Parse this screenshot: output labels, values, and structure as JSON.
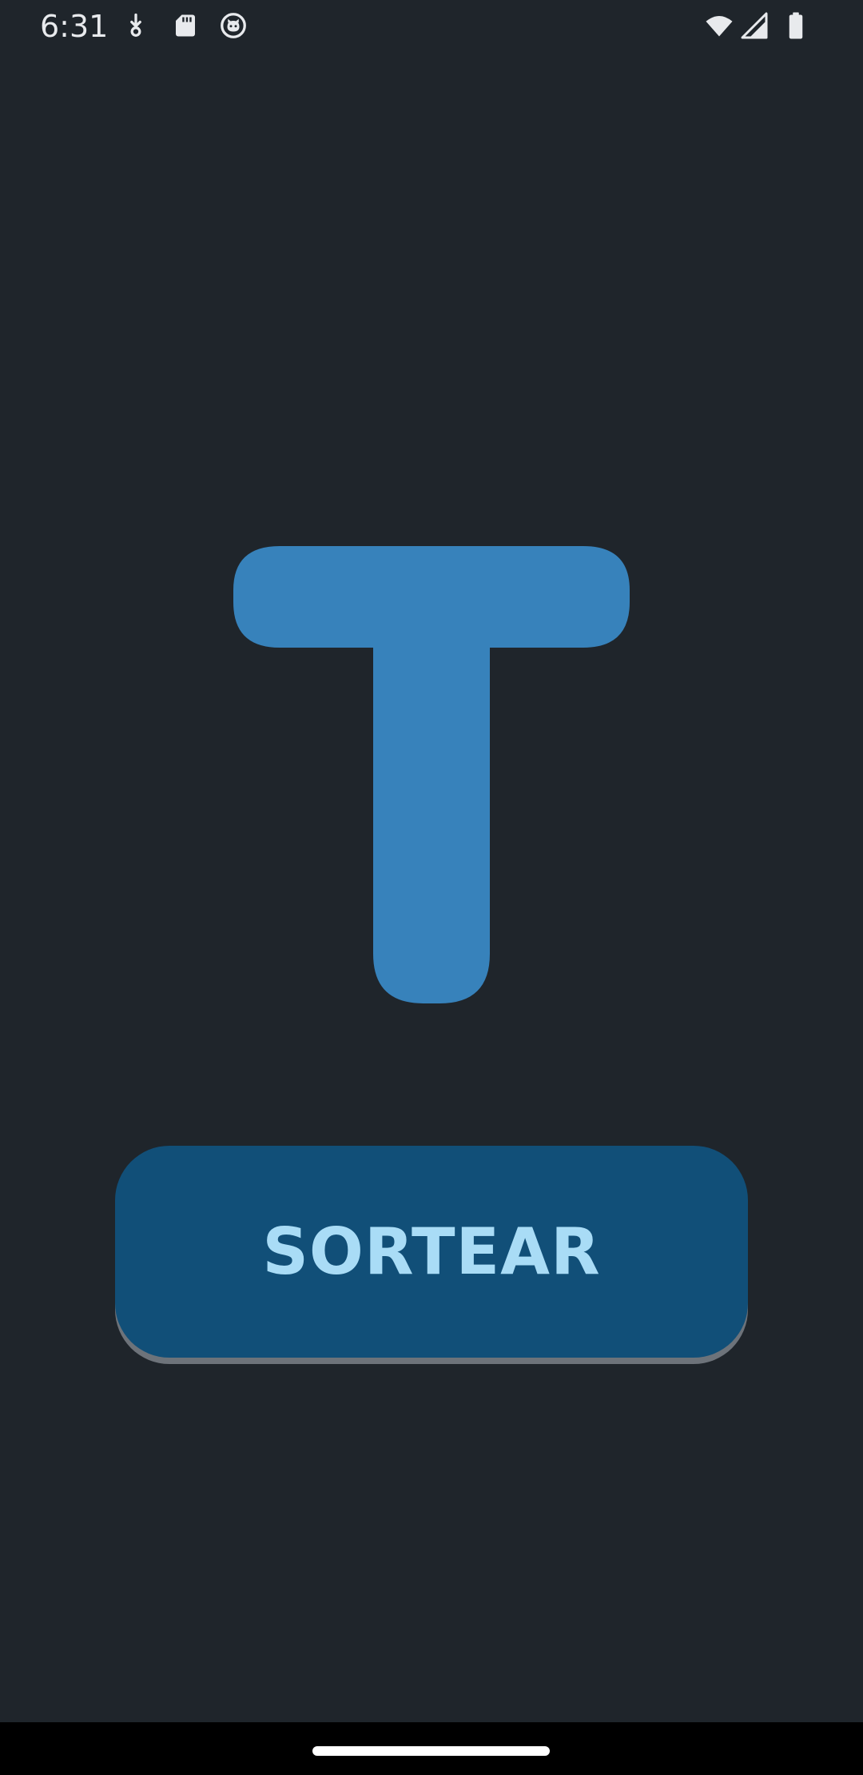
{
  "status_bar": {
    "time": "6:31",
    "icons": [
      "download-icon",
      "sd-card-icon",
      "cat-face-icon",
      "wifi-icon",
      "signal-icon",
      "battery-icon"
    ]
  },
  "letter": {
    "value": "T",
    "color": "#3782bb"
  },
  "draw_button": {
    "label": "SORTEAR",
    "background": "#114f78",
    "text_color": "#a9dcf6"
  },
  "colors": {
    "background": "#1f252b",
    "nav_bar": "#000000"
  }
}
